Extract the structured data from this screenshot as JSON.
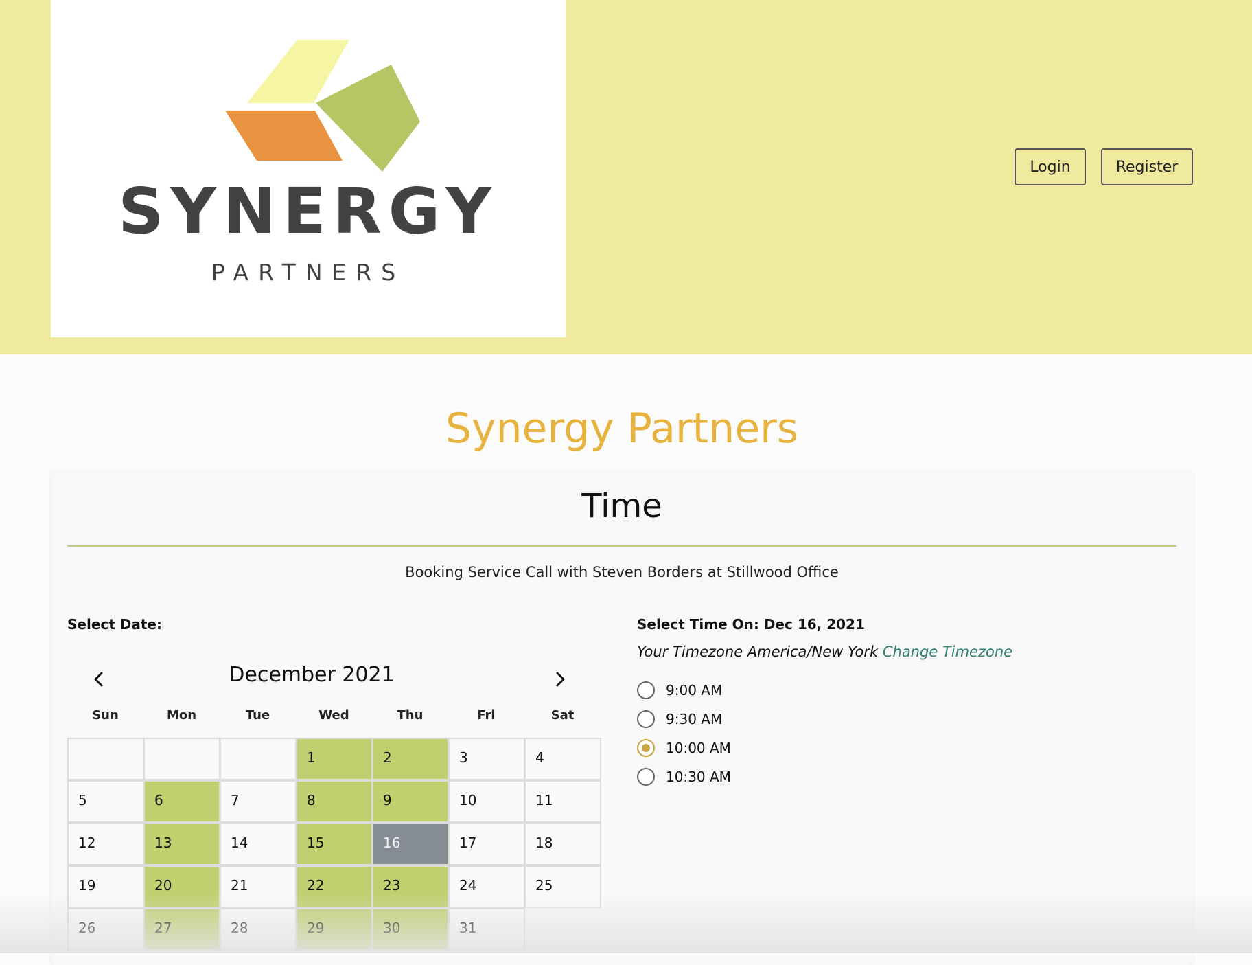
{
  "header": {
    "logo": {
      "name": "SYNERGY",
      "subtitle": "PARTNERS"
    },
    "login_label": "Login",
    "register_label": "Register"
  },
  "site_title": "Synergy Partners",
  "card": {
    "title": "Time",
    "booking_text": "Booking Service Call with Steven Borders at Stillwood Office"
  },
  "calendar": {
    "select_date_label": "Select Date:",
    "month_label": "December 2021",
    "weekdays": [
      "Sun",
      "Mon",
      "Tue",
      "Wed",
      "Thu",
      "Fri",
      "Sat"
    ],
    "weeks": [
      [
        {
          "day": "",
          "state": "empty"
        },
        {
          "day": "",
          "state": "empty"
        },
        {
          "day": "",
          "state": "empty"
        },
        {
          "day": "1",
          "state": "available"
        },
        {
          "day": "2",
          "state": "available"
        },
        {
          "day": "3",
          "state": "unavailable"
        },
        {
          "day": "4",
          "state": "unavailable"
        }
      ],
      [
        {
          "day": "5",
          "state": "unavailable"
        },
        {
          "day": "6",
          "state": "available"
        },
        {
          "day": "7",
          "state": "unavailable"
        },
        {
          "day": "8",
          "state": "available"
        },
        {
          "day": "9",
          "state": "available"
        },
        {
          "day": "10",
          "state": "unavailable"
        },
        {
          "day": "11",
          "state": "unavailable"
        }
      ],
      [
        {
          "day": "12",
          "state": "unavailable"
        },
        {
          "day": "13",
          "state": "available"
        },
        {
          "day": "14",
          "state": "unavailable"
        },
        {
          "day": "15",
          "state": "available"
        },
        {
          "day": "16",
          "state": "selected"
        },
        {
          "day": "17",
          "state": "unavailable"
        },
        {
          "day": "18",
          "state": "unavailable"
        }
      ],
      [
        {
          "day": "19",
          "state": "unavailable"
        },
        {
          "day": "20",
          "state": "available"
        },
        {
          "day": "21",
          "state": "unavailable"
        },
        {
          "day": "22",
          "state": "available"
        },
        {
          "day": "23",
          "state": "available"
        },
        {
          "day": "24",
          "state": "unavailable"
        },
        {
          "day": "25",
          "state": "unavailable"
        }
      ],
      [
        {
          "day": "26",
          "state": "unavailable"
        },
        {
          "day": "27",
          "state": "available"
        },
        {
          "day": "28",
          "state": "unavailable"
        },
        {
          "day": "29",
          "state": "available"
        },
        {
          "day": "30",
          "state": "available"
        },
        {
          "day": "31",
          "state": "unavailable"
        }
      ]
    ]
  },
  "time_panel": {
    "heading": "Select Time On: Dec 16, 2021",
    "timezone_text": "Your Timezone America/New York",
    "change_timezone_label": "Change Timezone",
    "slots": [
      {
        "label": "9:00 AM",
        "selected": false
      },
      {
        "label": "9:30 AM",
        "selected": false
      },
      {
        "label": "10:00 AM",
        "selected": true
      },
      {
        "label": "10:30 AM",
        "selected": false
      }
    ]
  },
  "colors": {
    "header_bg": "#f0ea9f",
    "title_accent": "#e7b33f",
    "available_day": "#c2cf6f",
    "selected_day": "#858c94",
    "radio_selected": "#c9a441",
    "link": "#2f8070"
  },
  "icons": {
    "prev_month": "chevron-left-icon",
    "next_month": "chevron-right-icon"
  }
}
